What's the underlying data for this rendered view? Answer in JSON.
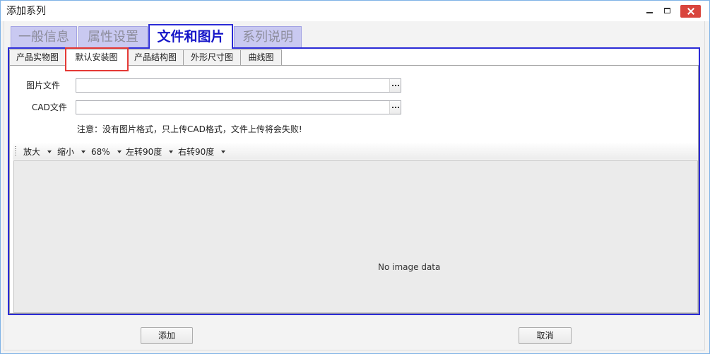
{
  "window": {
    "title": "添加系列",
    "minimize_icon": "minimize-icon",
    "maximize_icon": "maximize-icon",
    "close_icon": "close-icon"
  },
  "main_tabs": [
    {
      "label": "一般信息",
      "active": false
    },
    {
      "label": "属性设置",
      "active": false
    },
    {
      "label": "文件和图片",
      "active": true
    },
    {
      "label": "系列说明",
      "active": false
    }
  ],
  "sub_tabs": [
    {
      "label": "产品实物图",
      "active": false
    },
    {
      "label": "默认安装图",
      "active": true,
      "highlighted": true
    },
    {
      "label": "产品结构图",
      "active": false
    },
    {
      "label": "外形尺寸图",
      "active": false
    },
    {
      "label": "曲线图",
      "active": false
    }
  ],
  "form": {
    "image_file": {
      "label": "图片文件",
      "value": "",
      "browse_icon": "ellipsis-icon"
    },
    "cad_file": {
      "label": "CAD文件",
      "value": "",
      "browse_icon": "ellipsis-icon"
    },
    "note": "注意：没有图片格式，只上传CAD格式，文件上传将会失败!"
  },
  "toolbar": {
    "grip_icon": "grip-icon",
    "items": [
      {
        "label": "放大",
        "icon": "caret-down-icon"
      },
      {
        "label": "缩小",
        "icon": "caret-down-icon"
      },
      {
        "label": "68%",
        "icon": "caret-down-icon"
      },
      {
        "label": "左转90度",
        "icon": "caret-down-icon"
      },
      {
        "label": "右转90度",
        "icon": "caret-down-icon"
      }
    ]
  },
  "viewer": {
    "empty_text": "No image data"
  },
  "footer": {
    "add_label": "添加",
    "cancel_label": "取消"
  },
  "colors": {
    "accent_blue": "#2b2bd6",
    "active_tab_text": "#1414c8",
    "inactive_tab_bg": "#c9c9f1",
    "inactive_tab_text": "#8d8d9c",
    "highlight_red": "#e53935",
    "close_button": "#d9453d",
    "window_frame": "#7fb2e6"
  }
}
